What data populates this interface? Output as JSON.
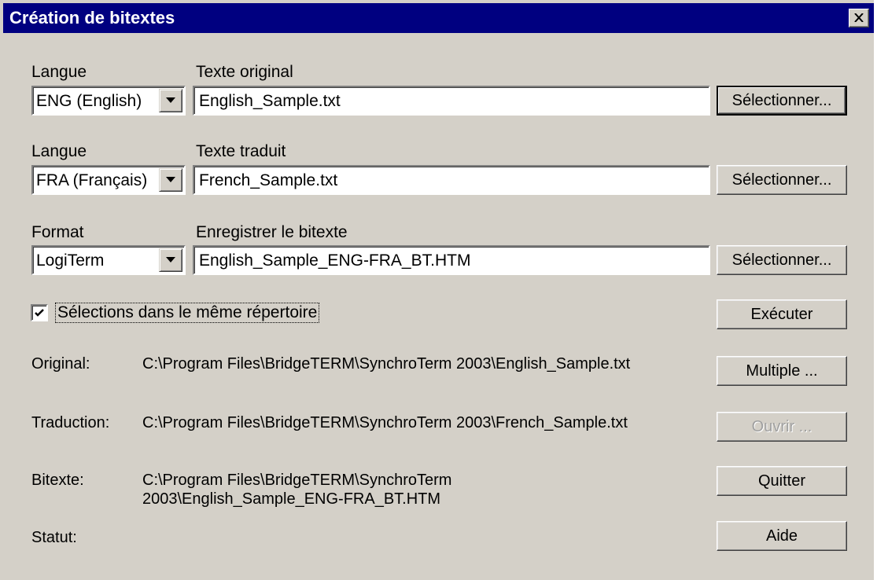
{
  "window": {
    "title": "Création de bitextes"
  },
  "rows": {
    "original": {
      "lang_label": "Langue",
      "lang_value": "ENG (English)",
      "file_label": "Texte original",
      "file_value": "English_Sample.txt",
      "button": "Sélectionner..."
    },
    "translated": {
      "lang_label": "Langue",
      "lang_value": "FRA (Français)",
      "file_label": "Texte traduit",
      "file_value": "French_Sample.txt",
      "button": "Sélectionner..."
    },
    "output": {
      "format_label": "Format",
      "format_value": "LogiTerm",
      "file_label": "Enregistrer le bitexte",
      "file_value": "English_Sample_ENG-FRA_BT.HTM",
      "button": "Sélectionner..."
    }
  },
  "same_dir": {
    "checked": true,
    "label": "Sélections dans le même répertoire"
  },
  "info": {
    "original_label": "Original:",
    "original_path": "C:\\Program Files\\BridgeTERM\\SynchroTerm 2003\\English_Sample.txt",
    "translation_label": "Traduction:",
    "translation_path": "C:\\Program Files\\BridgeTERM\\SynchroTerm 2003\\French_Sample.txt",
    "bitext_label": "Bitexte:",
    "bitext_path_line1": "C:\\Program Files\\BridgeTERM\\SynchroTerm",
    "bitext_path_line2": "2003\\English_Sample_ENG-FRA_BT.HTM",
    "status_label": "Statut:"
  },
  "buttons": {
    "execute": "Exécuter",
    "multiple": "Multiple ...",
    "open": "Ouvrir ...",
    "quit": "Quitter",
    "help": "Aide"
  }
}
